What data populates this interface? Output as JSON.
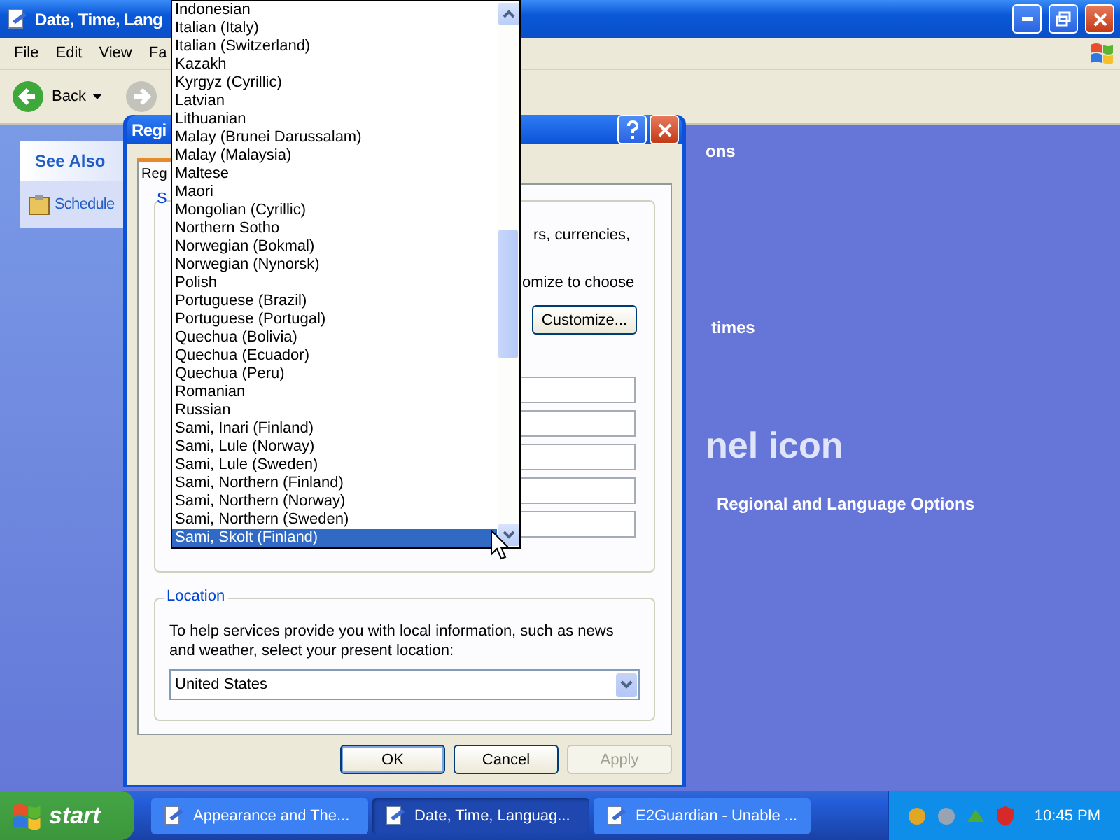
{
  "explorer": {
    "title": "Date, Time, Lang",
    "menu": [
      "File",
      "Edit",
      "View",
      "Fa"
    ],
    "back": "Back",
    "see_also": {
      "title": "See Also",
      "items": [
        "Schedule"
      ]
    },
    "content": {
      "heading": "ons",
      "task": "times",
      "panel_title": "nel icon",
      "link": "Regional and Language Options"
    }
  },
  "dialog": {
    "title": "Regi",
    "tabs": [
      {
        "label": "Reg",
        "selected": true
      }
    ],
    "formats": {
      "label": "S",
      "lines": [
        "rs, currencies,",
        "omize to choose"
      ],
      "customize": "Customize...",
      "fields": [
        {
          "kind": "field"
        },
        {
          "kind": "field"
        },
        {
          "kind": "field"
        },
        {
          "kind": "field"
        },
        {
          "kind": "field"
        }
      ]
    },
    "location": {
      "label": "Location",
      "text": "To help services provide you with local information, such as news and weather, select your present location:",
      "value": "United States"
    },
    "buttons": [
      {
        "label": "OK",
        "disabled": false,
        "default": true
      },
      {
        "label": "Cancel",
        "disabled": false,
        "default": false
      },
      {
        "label": "Apply",
        "disabled": true,
        "default": false
      }
    ]
  },
  "dropdown": {
    "items": [
      {
        "label": "Indonesian",
        "selected": false
      },
      {
        "label": "Italian (Italy)",
        "selected": false
      },
      {
        "label": "Italian (Switzerland)",
        "selected": false
      },
      {
        "label": "Kazakh",
        "selected": false
      },
      {
        "label": "Kyrgyz (Cyrillic)",
        "selected": false
      },
      {
        "label": "Latvian",
        "selected": false
      },
      {
        "label": "Lithuanian",
        "selected": false
      },
      {
        "label": "Malay (Brunei Darussalam)",
        "selected": false
      },
      {
        "label": "Malay (Malaysia)",
        "selected": false
      },
      {
        "label": "Maltese",
        "selected": false
      },
      {
        "label": "Maori",
        "selected": false
      },
      {
        "label": "Mongolian (Cyrillic)",
        "selected": false
      },
      {
        "label": "Northern Sotho",
        "selected": false
      },
      {
        "label": "Norwegian (Bokmal)",
        "selected": false
      },
      {
        "label": "Norwegian (Nynorsk)",
        "selected": false
      },
      {
        "label": "Polish",
        "selected": false
      },
      {
        "label": "Portuguese (Brazil)",
        "selected": false
      },
      {
        "label": "Portuguese (Portugal)",
        "selected": false
      },
      {
        "label": "Quechua (Bolivia)",
        "selected": false
      },
      {
        "label": "Quechua (Ecuador)",
        "selected": false
      },
      {
        "label": "Quechua (Peru)",
        "selected": false
      },
      {
        "label": "Romanian",
        "selected": false
      },
      {
        "label": "Russian",
        "selected": false
      },
      {
        "label": "Sami, Inari (Finland)",
        "selected": false
      },
      {
        "label": "Sami, Lule (Norway)",
        "selected": false
      },
      {
        "label": "Sami, Lule (Sweden)",
        "selected": false
      },
      {
        "label": "Sami, Northern (Finland)",
        "selected": false
      },
      {
        "label": "Sami, Northern (Norway)",
        "selected": false
      },
      {
        "label": "Sami, Northern (Sweden)",
        "selected": false
      },
      {
        "label": "Sami, Skolt (Finland)",
        "selected": true
      }
    ]
  },
  "taskbar": {
    "start": "start",
    "tasks": [
      {
        "label": "Appearance and The...",
        "selected": false
      },
      {
        "label": "Date, Time, Languag...",
        "selected": true
      },
      {
        "label": "E2Guardian - Unable ...",
        "selected": false
      }
    ],
    "clock": "10:45 PM"
  }
}
